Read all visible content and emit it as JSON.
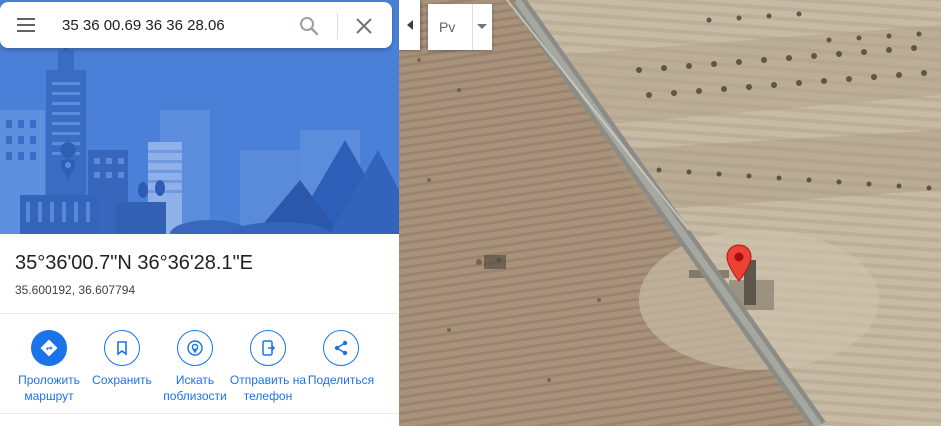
{
  "search": {
    "query": "35 36 00.69 36 36 28.06"
  },
  "place": {
    "dms": "35°36'00.7\"N 36°36'28.1\"E",
    "decimal": "35.600192, 36.607794"
  },
  "actions": [
    {
      "label": "Проложить маршрут",
      "icon": "directions-icon"
    },
    {
      "label": "Сохранить",
      "icon": "bookmark-icon"
    },
    {
      "label": "Искать поблизости",
      "icon": "nearby-icon"
    },
    {
      "label": "Отправить на телефон",
      "icon": "send-to-phone-icon"
    },
    {
      "label": "Поделиться",
      "icon": "share-icon"
    }
  ],
  "map": {
    "language_label": "Рv",
    "pin_color": "#ea4335"
  },
  "colors": {
    "accent": "#1a73e8",
    "hero_bg": "#4a7fd6"
  }
}
